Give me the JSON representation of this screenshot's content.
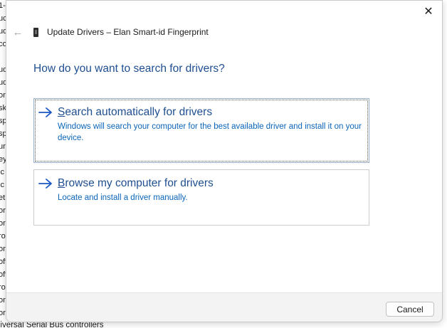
{
  "background": {
    "left_fragments": [
      "1-",
      "uc",
      "ud",
      "co",
      "",
      "ud",
      "ud",
      "or",
      "sk",
      "sp",
      "sp",
      "ur",
      "ey",
      "ic",
      "ic",
      "et",
      "or",
      "or",
      "ro",
      "or",
      "oft",
      "oft",
      "ro",
      "or",
      "or"
    ],
    "bottom_text": "niversal Serial Bus controllers"
  },
  "dialog": {
    "close_glyph": "✕",
    "back_glyph": "←",
    "title": "Update Drivers – Elan Smart-id Fingerprint",
    "question": "How do you want to search for drivers?",
    "options": [
      {
        "accel": "S",
        "title_rest": "earch automatically for drivers",
        "description": "Windows will search your computer for the best available driver and install it on your device."
      },
      {
        "accel": "B",
        "title_rest": "rowse my computer for drivers",
        "description": "Locate and install a driver manually."
      }
    ],
    "cancel_label": "Cancel"
  },
  "colors": {
    "heading_blue": "#1f4e91",
    "link_blue": "#0a64b8",
    "arrow_blue": "#1a56c4"
  }
}
